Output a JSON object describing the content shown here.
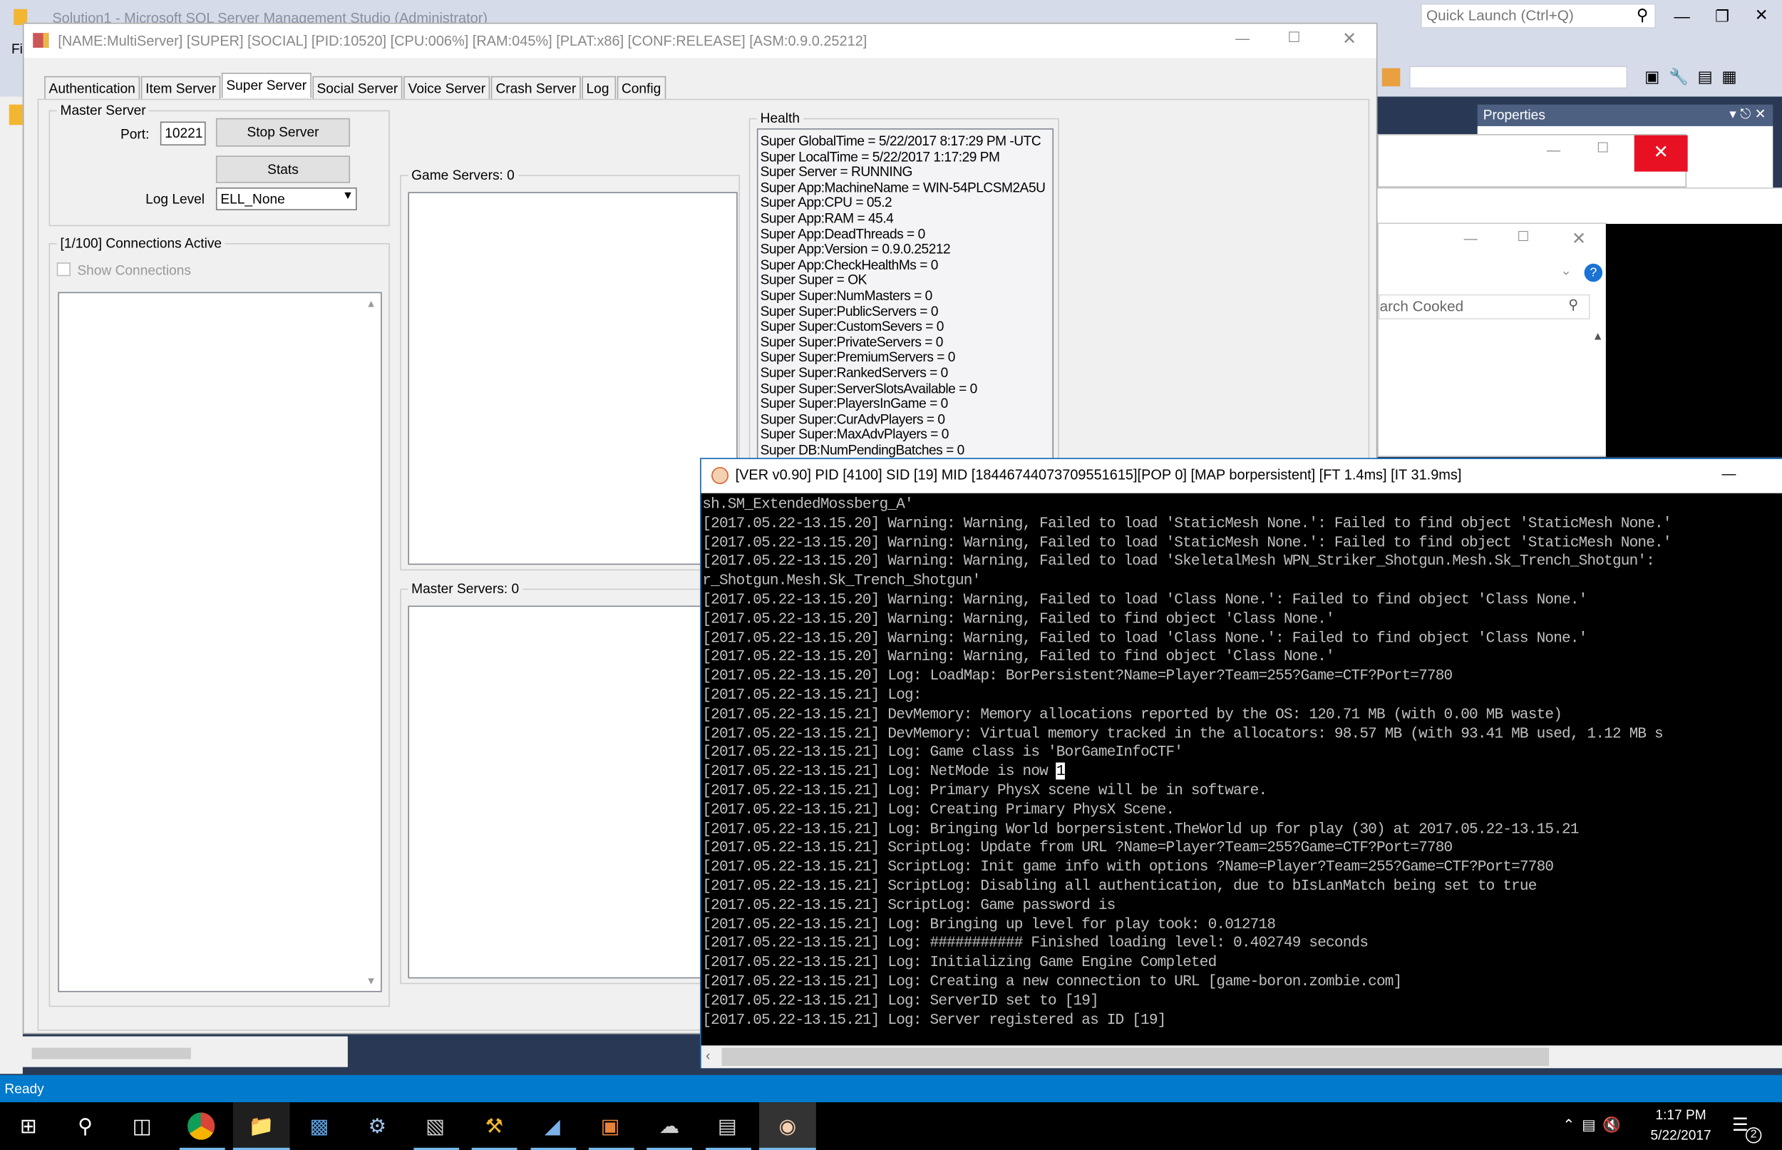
{
  "ssms": {
    "title": "Solution1 - Microsoft SQL Server Management Studio (Administrator)",
    "menu_fragment": "Fi",
    "quick_launch_placeholder": "Quick Launch (Ctrl+Q)",
    "properties_title": "Properties",
    "search_fragment": "arch Cooked",
    "status": "Ready"
  },
  "app": {
    "title": "[NAME:MultiServer] [SUPER] [SOCIAL] [PID:10520] [CPU:006%] [RAM:045%] [PLAT:x86] [CONF:RELEASE] [ASM:0.9.0.25212]",
    "tabs": [
      "Authentication",
      "Item Server",
      "Super Server",
      "Social Server",
      "Voice Server",
      "Crash Server",
      "Log",
      "Config"
    ],
    "selected_tab": "Super Server",
    "master_server": {
      "legend": "Master Server",
      "port_label": "Port:",
      "port_value": "10221",
      "stop_label": "Stop Server",
      "stats_label": "Stats",
      "log_level_label": "Log Level",
      "log_level_value": "ELL_None"
    },
    "connections": {
      "legend": "[1/100] Connections Active",
      "show_connections_label": "Show Connections",
      "show_connections_checked": false
    },
    "game_servers_legend": "Game Servers: 0",
    "master_servers_legend": "Master Servers: 0",
    "health": {
      "legend": "Health",
      "lines": [
        "Super GlobalTime = 5/22/2017 8:17:29 PM -UTC",
        "Super LocalTime = 5/22/2017 1:17:29 PM",
        "Super Server = RUNNING",
        "Super App:MachineName = WIN-54PLCSM2A5U",
        "Super App:CPU = 05.2",
        "Super App:RAM = 45.4",
        "Super App:DeadThreads = 0",
        "Super App:Version = 0.9.0.25212",
        "Super App:CheckHealthMs = 0",
        "Super Super = OK",
        "Super Super:NumMasters = 0",
        "Super Super:PublicServers = 0",
        "Super Super:CustomSevers = 0",
        "Super Super:PrivateServers = 0",
        "Super Super:PremiumServers = 0",
        "Super Super:RankedServers = 0",
        "Super Super:ServerSlotsAvailable = 0",
        "Super Super:PlayersInGame = 0",
        "Super Super:CurAdvPlayers = 0",
        "Super Super:MaxAdvPlayers = 0",
        "Super DB:NumPendingBatches = 0"
      ]
    }
  },
  "console": {
    "title": "[VER v0.90]  PID [4100] SID [19] MID [18446744073709551615][POP 0] [MAP borpersistent] [FT 1.4ms] [IT 31.9ms]",
    "lines": [
      "sh.SM_ExtendedMossberg_A'",
      "[2017.05.22-13.15.20] Warning: Warning, Failed to load 'StaticMesh None.': Failed to find object 'StaticMesh None.'",
      "[2017.05.22-13.15.20] Warning: Warning, Failed to load 'StaticMesh None.': Failed to find object 'StaticMesh None.'",
      "[2017.05.22-13.15.20] Warning: Warning, Failed to load 'SkeletalMesh WPN_Striker_Shotgun.Mesh.Sk_Trench_Shotgun': ",
      "r_Shotgun.Mesh.Sk_Trench_Shotgun'",
      "[2017.05.22-13.15.20] Warning: Warning, Failed to load 'Class None.': Failed to find object 'Class None.'",
      "[2017.05.22-13.15.20] Warning: Warning, Failed to find object 'Class None.'",
      "[2017.05.22-13.15.20] Warning: Warning, Failed to load 'Class None.': Failed to find object 'Class None.'",
      "[2017.05.22-13.15.20] Warning: Warning, Failed to find object 'Class None.'",
      "[2017.05.22-13.15.20] Log: LoadMap: BorPersistent?Name=Player?Team=255?Game=CTF?Port=7780",
      "[2017.05.22-13.15.21] Log:",
      "[2017.05.22-13.15.21] DevMemory: Memory allocations reported by the OS: 120.71 MB (with 0.00 MB waste)",
      "[2017.05.22-13.15.21] DevMemory: Virtual memory tracked in the allocators: 98.57 MB (with 93.41 MB used, 1.12 MB s",
      "[2017.05.22-13.15.21] Log: Game class is 'BorGameInfoCTF'",
      "[2017.05.22-13.15.21] Log: NetMode is now ",
      "[2017.05.22-13.15.21] Log: Primary PhysX scene will be in software.",
      "[2017.05.22-13.15.21] Log: Creating Primary PhysX Scene.",
      "[2017.05.22-13.15.21] Log: Bringing World borpersistent.TheWorld up for play (30) at 2017.05.22-13.15.21",
      "[2017.05.22-13.15.21] ScriptLog: Update from URL ?Name=Player?Team=255?Game=CTF?Port=7780",
      "[2017.05.22-13.15.21] ScriptLog: Init game info with options ?Name=Player?Team=255?Game=CTF?Port=7780",
      "[2017.05.22-13.15.21] ScriptLog: Disabling all authentication, due to bIsLanMatch being set to true",
      "[2017.05.22-13.15.21] ScriptLog: Game password is",
      "[2017.05.22-13.15.21] Log: Bringing up level for play took: 0.012718",
      "[2017.05.22-13.15.21] Log: ########### Finished loading level: 0.402749 seconds",
      "[2017.05.22-13.15.21] Log: Initializing Game Engine Completed",
      "[2017.05.22-13.15.21] Log: Creating a new connection to URL [game-boron.zombie.com]",
      "[2017.05.22-13.15.21] Log: ServerID set to [19]",
      "[2017.05.22-13.15.21] Log: Server registered as ID [19]"
    ],
    "cursor_char": "1"
  },
  "taskbar": {
    "time": "1:17 PM",
    "date": "5/22/2017",
    "notification_count": "2",
    "icons": [
      "windows-start-icon",
      "search-icon",
      "task-view-icon",
      "chrome-icon",
      "file-explorer-icon",
      "remote-desktop-icon",
      "settings-icon",
      "terminal-icon",
      "ssms-tools-icon",
      "app-icon",
      "app-icon-2",
      "network-app-icon",
      "app-icon-3",
      "game-server-icon"
    ]
  },
  "colors": {
    "accent": "#007acc",
    "ssms_dark": "#293955",
    "close_red": "#e81123",
    "console_bg": "#000000"
  }
}
